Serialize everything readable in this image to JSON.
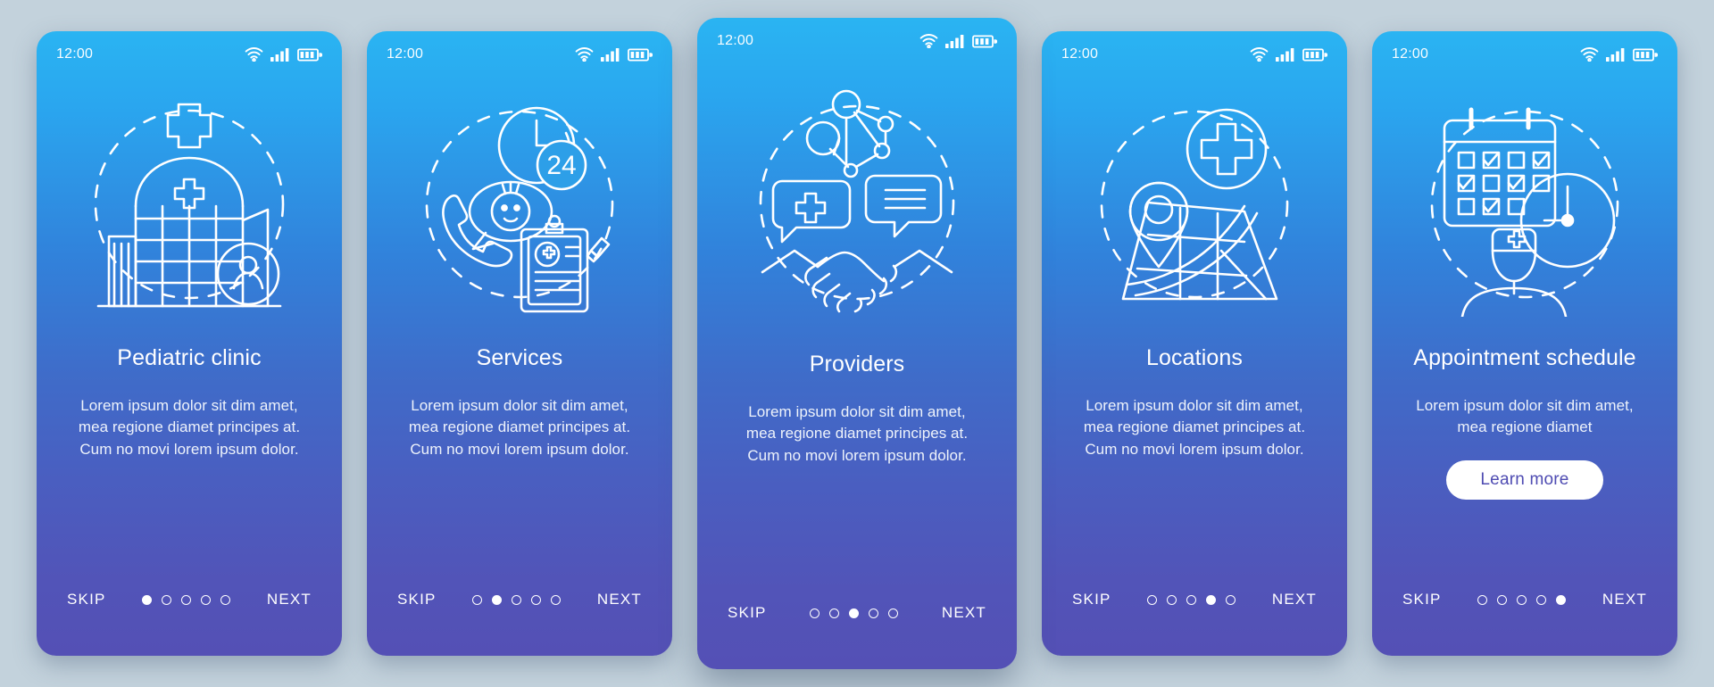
{
  "meta": {
    "background_color": "#c3d2dc",
    "card_gradient_top": "#2ab4f2",
    "card_gradient_bottom": "#5450b5",
    "accent_text_color": "#4e4bb2"
  },
  "status_bar": {
    "time": "12:00",
    "icons": [
      "wifi-icon",
      "cellular-signal-icon",
      "battery-icon"
    ]
  },
  "nav": {
    "skip_label": "SKIP",
    "next_label": "NEXT",
    "dot_count": 5
  },
  "screens": [
    {
      "id": "pediatric-clinic",
      "title": "Pediatric clinic",
      "description": "Lorem ipsum dolor sit dim amet, mea regione diamet principes at. Cum no movi lorem ipsum dolor.",
      "illustration": "hospital-building-icon",
      "active_dot": 1,
      "featured": false,
      "cta_label": null
    },
    {
      "id": "services",
      "title": "Services",
      "description": "Lorem ipsum dolor sit dim amet, mea regione diamet principes at. Cum no movi lorem ipsum dolor.",
      "illustration": "phone-support-24h-icon",
      "illustration_badge": "24",
      "active_dot": 2,
      "featured": false,
      "cta_label": null
    },
    {
      "id": "providers",
      "title": "Providers",
      "description": "Lorem ipsum dolor sit dim amet, mea regione diamet principes at. Cum no movi lorem ipsum dolor.",
      "illustration": "handshake-network-icon",
      "active_dot": 3,
      "featured": true,
      "cta_label": null
    },
    {
      "id": "locations",
      "title": "Locations",
      "description": "Lorem ipsum dolor sit dim amet, mea regione diamet principes at. Cum no movi lorem ipsum dolor.",
      "illustration": "map-pin-clinic-icon",
      "active_dot": 4,
      "featured": false,
      "cta_label": null
    },
    {
      "id": "appointment-schedule",
      "title": "Appointment schedule",
      "description": "Lorem ipsum dolor sit dim amet, mea regione diamet",
      "illustration": "calendar-clock-doctor-icon",
      "active_dot": 5,
      "featured": false,
      "cta_label": "Learn more"
    }
  ]
}
